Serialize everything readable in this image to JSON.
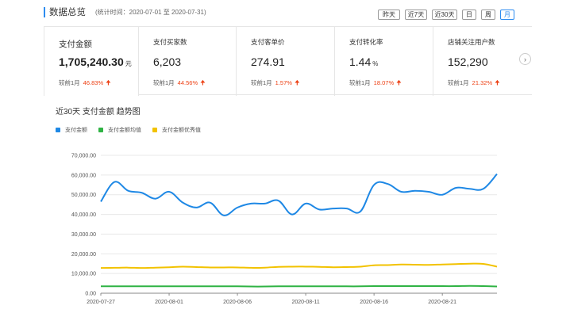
{
  "header": {
    "title": "数据总览",
    "subtitle": "(统计时间：2020-07-01 至 2020-07-31)"
  },
  "range_buttons": [
    {
      "label": "昨天",
      "active": false
    },
    {
      "label": "近7天",
      "active": false
    },
    {
      "label": "近30天",
      "active": false
    },
    {
      "label": "日",
      "active": false
    },
    {
      "label": "周",
      "active": false
    },
    {
      "label": "月",
      "active": true
    }
  ],
  "cards": [
    {
      "label": "支付金额",
      "value": "1,705,240.30",
      "unit": "元",
      "compare": "较前1月",
      "pct": "46.83%",
      "trend": "up"
    },
    {
      "label": "支付买家数",
      "value": "6,203",
      "unit": "",
      "compare": "较前1月",
      "pct": "44.56%",
      "trend": "up"
    },
    {
      "label": "支付客单价",
      "value": "274.91",
      "unit": "",
      "compare": "较前1月",
      "pct": "1.57%",
      "trend": "up"
    },
    {
      "label": "支付转化率",
      "value": "1.44",
      "unit": "%",
      "compare": "较前1月",
      "pct": "18.07%",
      "trend": "up"
    },
    {
      "label": "店铺关注用户数",
      "value": "152,290",
      "unit": "",
      "compare": "较前1月",
      "pct": "21.32%",
      "trend": "up"
    }
  ],
  "next_icon": "chevron-right-icon",
  "colors": {
    "accent": "#2d8cf0",
    "up": "#ed4014",
    "series_blue": "#1e88e5",
    "series_green": "#2fb344",
    "series_yellow": "#f2c200"
  },
  "chart_title": "近30天 支付金额 趋势图",
  "chart_data": {
    "type": "line",
    "title": "近30天 支付金额 趋势图",
    "xlabel": "",
    "ylabel": "",
    "ylim": [
      0,
      70000
    ],
    "yticks": [
      "0.00",
      "10,000.00",
      "20,000.00",
      "30,000.00",
      "40,000.00",
      "50,000.00",
      "60,000.00",
      "70,000.00"
    ],
    "xticks": [
      "2020-07-27",
      "2020-08-01",
      "2020-08-06",
      "2020-08-11",
      "2020-08-16",
      "2020-08-21"
    ],
    "x": [
      "2020-07-27",
      "2020-07-28",
      "2020-07-29",
      "2020-07-30",
      "2020-07-31",
      "2020-08-01",
      "2020-08-02",
      "2020-08-03",
      "2020-08-04",
      "2020-08-05",
      "2020-08-06",
      "2020-08-07",
      "2020-08-08",
      "2020-08-09",
      "2020-08-10",
      "2020-08-11",
      "2020-08-12",
      "2020-08-13",
      "2020-08-14",
      "2020-08-15",
      "2020-08-16",
      "2020-08-17",
      "2020-08-18",
      "2020-08-19",
      "2020-08-20",
      "2020-08-21",
      "2020-08-22",
      "2020-08-23",
      "2020-08-24",
      "2020-08-25"
    ],
    "legend_position": "top-left",
    "grid": true,
    "series": [
      {
        "name": "支付金额",
        "color": "#1e88e5",
        "values": [
          46500,
          56500,
          52000,
          51000,
          48000,
          51500,
          46000,
          43500,
          46000,
          39500,
          43500,
          45500,
          45500,
          47000,
          40000,
          45500,
          42500,
          43000,
          43000,
          41500,
          55000,
          55500,
          51500,
          52000,
          51500,
          50000,
          53500,
          53000,
          53000,
          60500
        ]
      },
      {
        "name": "支付金额均值",
        "color": "#2fb344",
        "values": [
          3500,
          3500,
          3500,
          3500,
          3500,
          3500,
          3500,
          3500,
          3500,
          3500,
          3500,
          3400,
          3400,
          3500,
          3500,
          3500,
          3500,
          3500,
          3500,
          3500,
          3600,
          3600,
          3600,
          3600,
          3600,
          3600,
          3600,
          3700,
          3600,
          3400
        ]
      },
      {
        "name": "支付金额优秀值",
        "color": "#f2c200",
        "values": [
          12800,
          12900,
          13000,
          12800,
          13000,
          13200,
          13500,
          13300,
          13100,
          13100,
          13100,
          12900,
          13000,
          13400,
          13500,
          13500,
          13400,
          13200,
          13300,
          13500,
          14200,
          14300,
          14600,
          14500,
          14400,
          14600,
          14800,
          15000,
          14900,
          13500
        ]
      }
    ]
  }
}
